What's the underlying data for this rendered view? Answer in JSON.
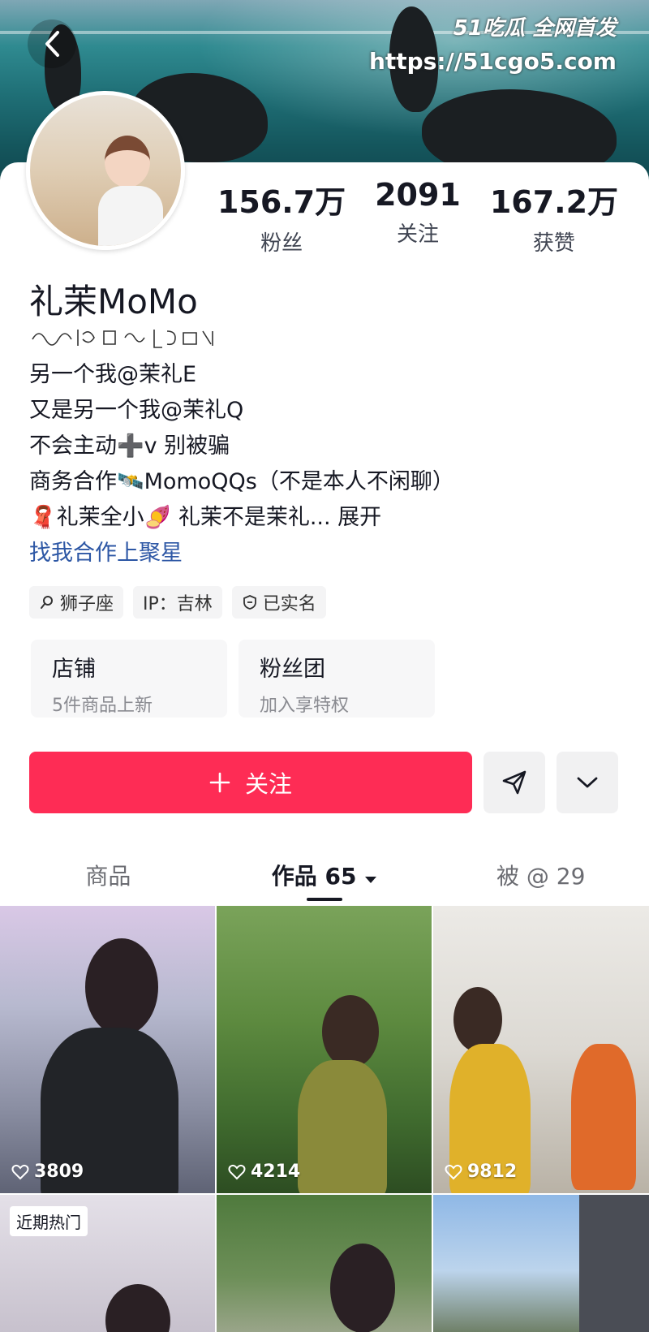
{
  "watermark": {
    "brand": "51吃瓜 全网首发",
    "url": "https://51cgo5.com"
  },
  "profile": {
    "stats": [
      {
        "value": "156.7万",
        "label": "粉丝"
      },
      {
        "value": "2091",
        "label": "关注"
      },
      {
        "value": "167.2万",
        "label": "获赞"
      }
    ],
    "name": "礼茉MoMo",
    "bio_lines": [
      "另一个我@茉礼E",
      "又是另一个我@茉礼Q",
      "不会主动➕v 别被骗",
      "商务合作🛰️MomoQQs（不是本人不闲聊）",
      "🧣礼茉全小🍠 礼茉不是茉礼..."
    ],
    "expand_label": "展开",
    "link_text": "找我合作上聚星",
    "tags": [
      {
        "icon": "search-icon",
        "text": "狮子座"
      },
      {
        "icon": "",
        "text": "IP：吉林"
      },
      {
        "icon": "verified-icon",
        "text": "已实名"
      }
    ],
    "boxes": [
      {
        "title": "店铺",
        "sub": "5件商品上新"
      },
      {
        "title": "粉丝团",
        "sub": "加入享特权"
      }
    ],
    "follow_label": "关注"
  },
  "tabs": [
    {
      "label": "商品",
      "active": false
    },
    {
      "label": "作品 65",
      "active": true
    },
    {
      "label": "被 @ 29",
      "active": false
    }
  ],
  "videos": [
    {
      "likes": "3809"
    },
    {
      "likes": "4214"
    },
    {
      "likes": "9812"
    },
    {
      "badge": "近期热门"
    },
    {},
    {}
  ],
  "colors": {
    "accent": "#fe2c55",
    "link": "#2d57a5"
  }
}
